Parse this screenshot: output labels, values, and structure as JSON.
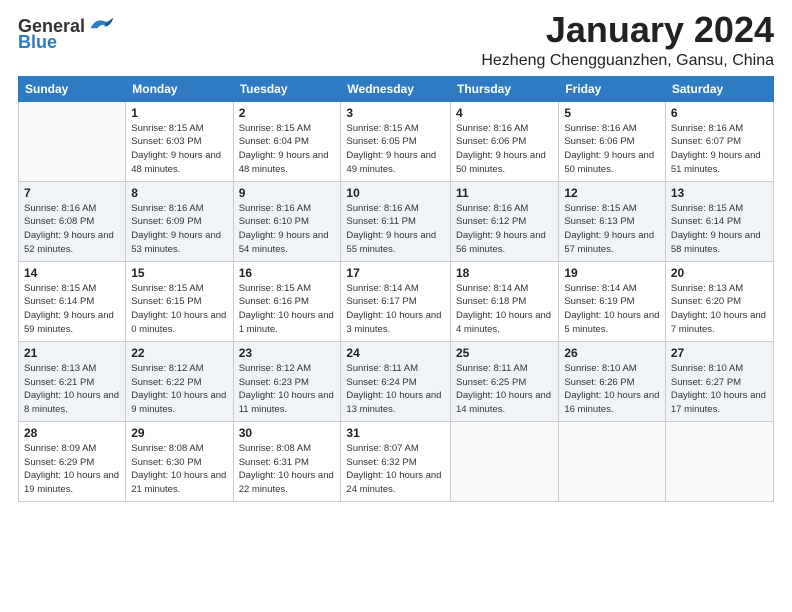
{
  "logo": {
    "general": "General",
    "blue": "Blue"
  },
  "title": "January 2024",
  "location": "Hezheng Chengguanzhen, Gansu, China",
  "days_of_week": [
    "Sunday",
    "Monday",
    "Tuesday",
    "Wednesday",
    "Thursday",
    "Friday",
    "Saturday"
  ],
  "weeks": [
    [
      {
        "day": "",
        "sunrise": "",
        "sunset": "",
        "daylight": ""
      },
      {
        "day": "1",
        "sunrise": "Sunrise: 8:15 AM",
        "sunset": "Sunset: 6:03 PM",
        "daylight": "Daylight: 9 hours and 48 minutes."
      },
      {
        "day": "2",
        "sunrise": "Sunrise: 8:15 AM",
        "sunset": "Sunset: 6:04 PM",
        "daylight": "Daylight: 9 hours and 48 minutes."
      },
      {
        "day": "3",
        "sunrise": "Sunrise: 8:15 AM",
        "sunset": "Sunset: 6:05 PM",
        "daylight": "Daylight: 9 hours and 49 minutes."
      },
      {
        "day": "4",
        "sunrise": "Sunrise: 8:16 AM",
        "sunset": "Sunset: 6:06 PM",
        "daylight": "Daylight: 9 hours and 50 minutes."
      },
      {
        "day": "5",
        "sunrise": "Sunrise: 8:16 AM",
        "sunset": "Sunset: 6:06 PM",
        "daylight": "Daylight: 9 hours and 50 minutes."
      },
      {
        "day": "6",
        "sunrise": "Sunrise: 8:16 AM",
        "sunset": "Sunset: 6:07 PM",
        "daylight": "Daylight: 9 hours and 51 minutes."
      }
    ],
    [
      {
        "day": "7",
        "sunrise": "Sunrise: 8:16 AM",
        "sunset": "Sunset: 6:08 PM",
        "daylight": "Daylight: 9 hours and 52 minutes."
      },
      {
        "day": "8",
        "sunrise": "Sunrise: 8:16 AM",
        "sunset": "Sunset: 6:09 PM",
        "daylight": "Daylight: 9 hours and 53 minutes."
      },
      {
        "day": "9",
        "sunrise": "Sunrise: 8:16 AM",
        "sunset": "Sunset: 6:10 PM",
        "daylight": "Daylight: 9 hours and 54 minutes."
      },
      {
        "day": "10",
        "sunrise": "Sunrise: 8:16 AM",
        "sunset": "Sunset: 6:11 PM",
        "daylight": "Daylight: 9 hours and 55 minutes."
      },
      {
        "day": "11",
        "sunrise": "Sunrise: 8:16 AM",
        "sunset": "Sunset: 6:12 PM",
        "daylight": "Daylight: 9 hours and 56 minutes."
      },
      {
        "day": "12",
        "sunrise": "Sunrise: 8:15 AM",
        "sunset": "Sunset: 6:13 PM",
        "daylight": "Daylight: 9 hours and 57 minutes."
      },
      {
        "day": "13",
        "sunrise": "Sunrise: 8:15 AM",
        "sunset": "Sunset: 6:14 PM",
        "daylight": "Daylight: 9 hours and 58 minutes."
      }
    ],
    [
      {
        "day": "14",
        "sunrise": "Sunrise: 8:15 AM",
        "sunset": "Sunset: 6:14 PM",
        "daylight": "Daylight: 9 hours and 59 minutes."
      },
      {
        "day": "15",
        "sunrise": "Sunrise: 8:15 AM",
        "sunset": "Sunset: 6:15 PM",
        "daylight": "Daylight: 10 hours and 0 minutes."
      },
      {
        "day": "16",
        "sunrise": "Sunrise: 8:15 AM",
        "sunset": "Sunset: 6:16 PM",
        "daylight": "Daylight: 10 hours and 1 minute."
      },
      {
        "day": "17",
        "sunrise": "Sunrise: 8:14 AM",
        "sunset": "Sunset: 6:17 PM",
        "daylight": "Daylight: 10 hours and 3 minutes."
      },
      {
        "day": "18",
        "sunrise": "Sunrise: 8:14 AM",
        "sunset": "Sunset: 6:18 PM",
        "daylight": "Daylight: 10 hours and 4 minutes."
      },
      {
        "day": "19",
        "sunrise": "Sunrise: 8:14 AM",
        "sunset": "Sunset: 6:19 PM",
        "daylight": "Daylight: 10 hours and 5 minutes."
      },
      {
        "day": "20",
        "sunrise": "Sunrise: 8:13 AM",
        "sunset": "Sunset: 6:20 PM",
        "daylight": "Daylight: 10 hours and 7 minutes."
      }
    ],
    [
      {
        "day": "21",
        "sunrise": "Sunrise: 8:13 AM",
        "sunset": "Sunset: 6:21 PM",
        "daylight": "Daylight: 10 hours and 8 minutes."
      },
      {
        "day": "22",
        "sunrise": "Sunrise: 8:12 AM",
        "sunset": "Sunset: 6:22 PM",
        "daylight": "Daylight: 10 hours and 9 minutes."
      },
      {
        "day": "23",
        "sunrise": "Sunrise: 8:12 AM",
        "sunset": "Sunset: 6:23 PM",
        "daylight": "Daylight: 10 hours and 11 minutes."
      },
      {
        "day": "24",
        "sunrise": "Sunrise: 8:11 AM",
        "sunset": "Sunset: 6:24 PM",
        "daylight": "Daylight: 10 hours and 13 minutes."
      },
      {
        "day": "25",
        "sunrise": "Sunrise: 8:11 AM",
        "sunset": "Sunset: 6:25 PM",
        "daylight": "Daylight: 10 hours and 14 minutes."
      },
      {
        "day": "26",
        "sunrise": "Sunrise: 8:10 AM",
        "sunset": "Sunset: 6:26 PM",
        "daylight": "Daylight: 10 hours and 16 minutes."
      },
      {
        "day": "27",
        "sunrise": "Sunrise: 8:10 AM",
        "sunset": "Sunset: 6:27 PM",
        "daylight": "Daylight: 10 hours and 17 minutes."
      }
    ],
    [
      {
        "day": "28",
        "sunrise": "Sunrise: 8:09 AM",
        "sunset": "Sunset: 6:29 PM",
        "daylight": "Daylight: 10 hours and 19 minutes."
      },
      {
        "day": "29",
        "sunrise": "Sunrise: 8:08 AM",
        "sunset": "Sunset: 6:30 PM",
        "daylight": "Daylight: 10 hours and 21 minutes."
      },
      {
        "day": "30",
        "sunrise": "Sunrise: 8:08 AM",
        "sunset": "Sunset: 6:31 PM",
        "daylight": "Daylight: 10 hours and 22 minutes."
      },
      {
        "day": "31",
        "sunrise": "Sunrise: 8:07 AM",
        "sunset": "Sunset: 6:32 PM",
        "daylight": "Daylight: 10 hours and 24 minutes."
      },
      {
        "day": "",
        "sunrise": "",
        "sunset": "",
        "daylight": ""
      },
      {
        "day": "",
        "sunrise": "",
        "sunset": "",
        "daylight": ""
      },
      {
        "day": "",
        "sunrise": "",
        "sunset": "",
        "daylight": ""
      }
    ]
  ]
}
